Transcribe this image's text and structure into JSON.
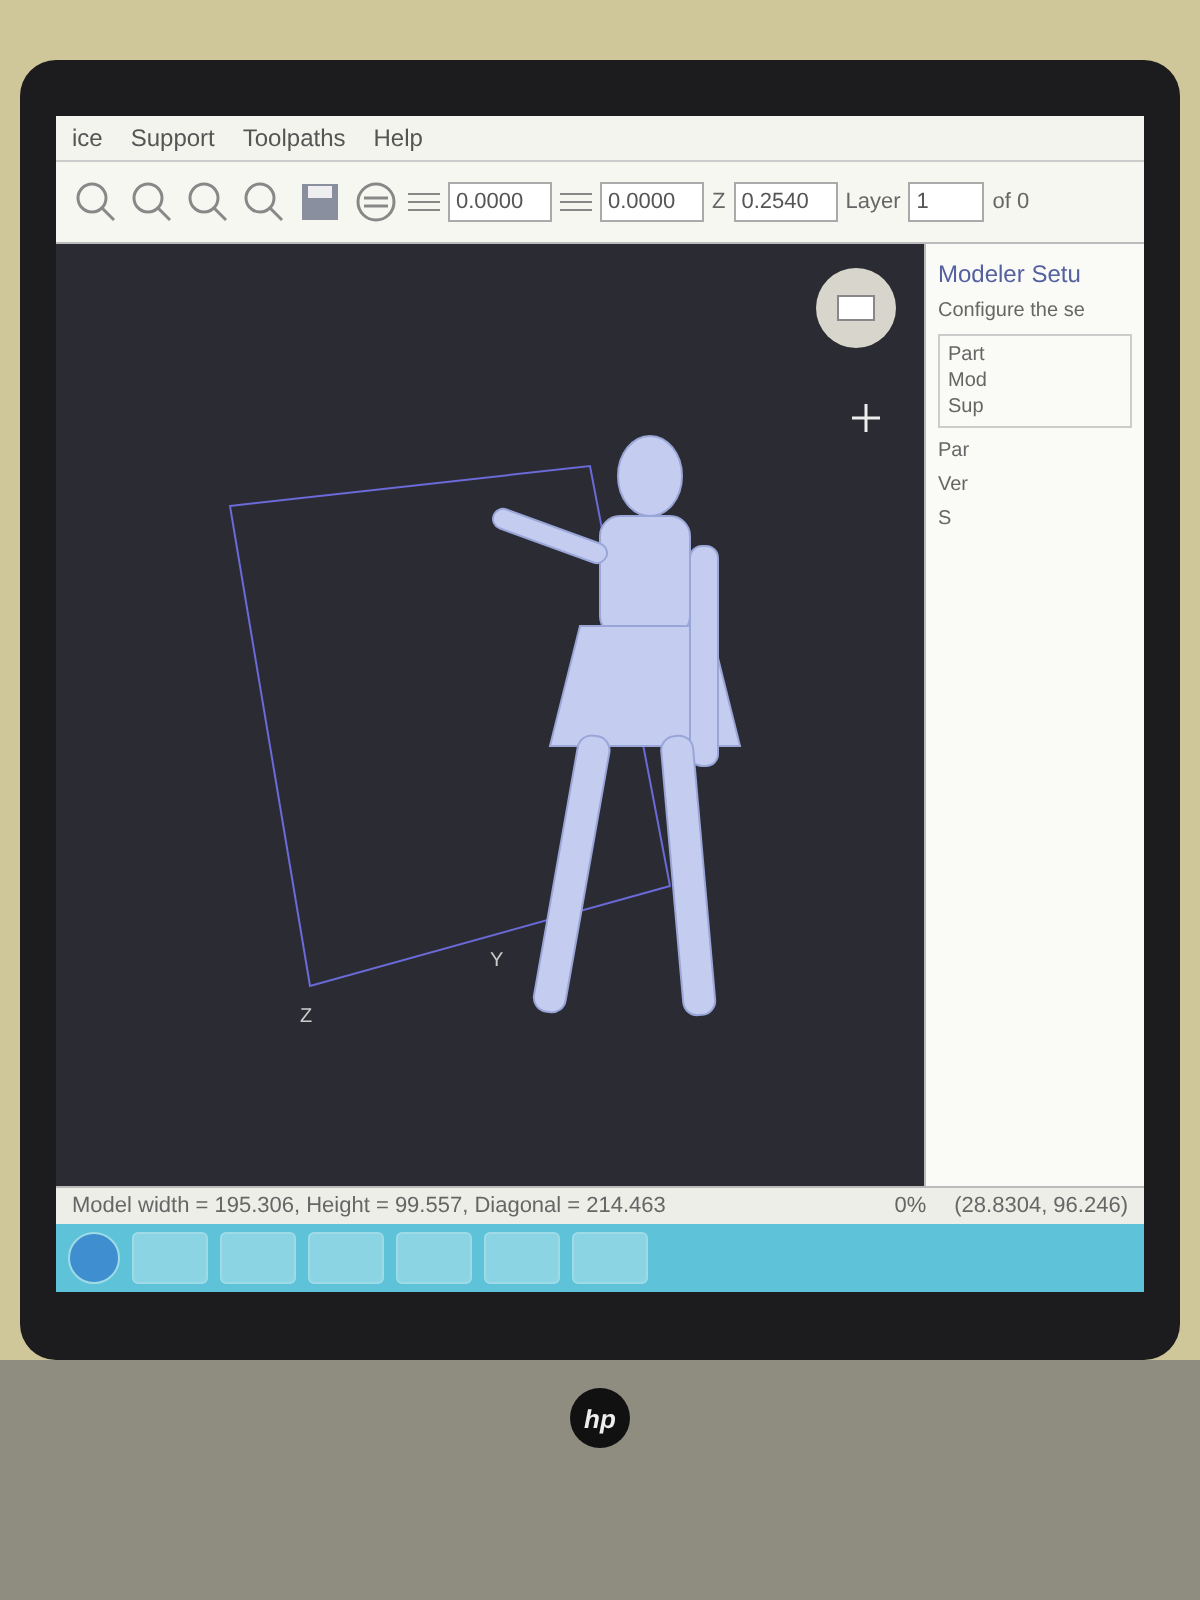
{
  "menu": [
    "ice",
    "Support",
    "Toolpaths",
    "Help"
  ],
  "toolbar": {
    "fields": [
      {
        "value": "0.0000"
      },
      {
        "value": "0.0000"
      }
    ],
    "z_label": "Z",
    "z_value": "0.2540",
    "layer_label": "Layer",
    "layer_value": "1",
    "layer_total": "of 0"
  },
  "viewport": {
    "axis_labels": [
      "Y",
      "Z"
    ]
  },
  "dialog": {
    "title": "Modeler Setu",
    "subtitle": "Configure the se",
    "group_lines": [
      "Part",
      "Mod",
      "Sup"
    ],
    "rows": [
      "Par",
      "Ver",
      "S"
    ]
  },
  "status_bar": {
    "left": "Model width = 195.306, Height = 99.557, Diagonal = 214.463",
    "percent": "0%",
    "coords": "(28.8304, 96.246)"
  },
  "taskbar": {
    "apps": [
      {
        "kind": "start"
      },
      {
        "kind": "app"
      },
      {
        "kind": "app"
      },
      {
        "kind": "app"
      },
      {
        "kind": "app"
      },
      {
        "kind": "app"
      },
      {
        "kind": "app"
      }
    ]
  },
  "laptop": {
    "logo": "hp"
  }
}
